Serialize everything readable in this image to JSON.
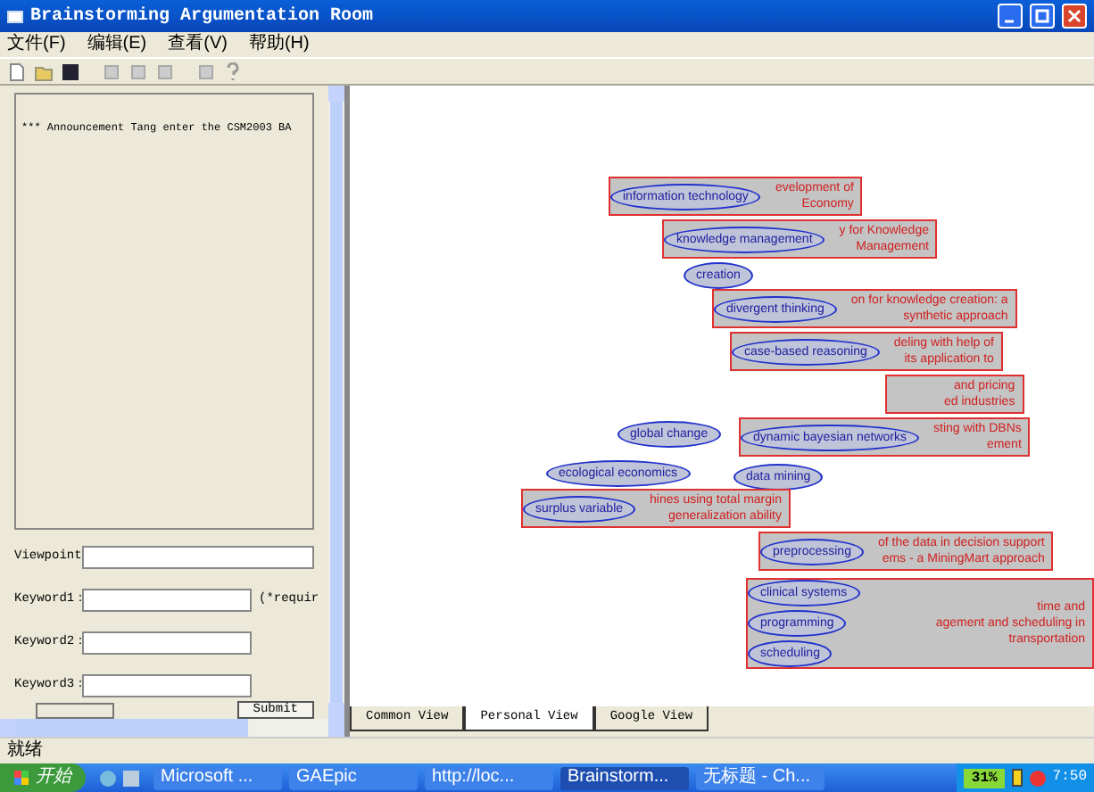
{
  "window": {
    "title": "Brainstorming Argumentation Room"
  },
  "menu": [
    "文件(F)",
    "编辑(E)",
    "查看(V)",
    "帮助(H)"
  ],
  "announcement": "*** Announcement  Tang enter the CSM2003 BA",
  "form": {
    "fields": [
      {
        "label": "Viewpoint"
      },
      {
        "label": "Keyword1：",
        "note": "(*requir"
      },
      {
        "label": "Keyword2："
      },
      {
        "label": "Keyword3："
      }
    ],
    "submit": "Submit"
  },
  "graph": {
    "nodes": [
      {
        "kind": "paper",
        "concepts": [
          "information technology"
        ],
        "lines": [
          "evelopment of",
          "Economy"
        ]
      },
      {
        "kind": "paper",
        "concepts": [
          "knowledge management"
        ],
        "lines": [
          "y for Knowledge",
          "Management"
        ]
      },
      {
        "kind": "concept",
        "label": "creation"
      },
      {
        "kind": "paper",
        "concepts": [
          "divergent thinking"
        ],
        "lines": [
          "on for knowledge creation: a",
          "synthetic approach"
        ]
      },
      {
        "kind": "paper",
        "concepts": [
          "case-based reasoning"
        ],
        "lines": [
          "deling with help of",
          "its application to"
        ]
      },
      {
        "kind": "paper",
        "lines": [
          "and pricing",
          "ed industries"
        ]
      },
      {
        "kind": "concept",
        "label": "global change"
      },
      {
        "kind": "paper",
        "concepts": [
          "dynamic bayesian networks"
        ],
        "lines": [
          "sting with DBNs",
          "ement"
        ]
      },
      {
        "kind": "concept",
        "label": "ecological economics"
      },
      {
        "kind": "concept",
        "label": "data mining"
      },
      {
        "kind": "paper",
        "concepts": [
          "surplus variable"
        ],
        "lines": [
          "hines using total margin",
          "generalization ability"
        ]
      },
      {
        "kind": "paper",
        "concepts": [
          "preprocessing"
        ],
        "lines": [
          "of the data in decision support",
          "ems - a MiningMart approach"
        ]
      },
      {
        "kind": "paper",
        "concepts": [
          "clinical systems",
          "programming",
          "scheduling"
        ],
        "lines": [
          "time and",
          "agement and scheduling in",
          "transportation"
        ]
      }
    ]
  },
  "tabs": [
    {
      "label": "Common View",
      "selected": false
    },
    {
      "label": "Personal View",
      "selected": true
    },
    {
      "label": "Google View",
      "selected": false
    }
  ],
  "status": "就绪",
  "taskbar": {
    "start": "开始",
    "tasks": [
      {
        "label": "Microsoft ...",
        "selected": false
      },
      {
        "label": "GAEpic",
        "selected": false
      },
      {
        "label": "http://loc...",
        "selected": false
      },
      {
        "label": "Brainstorm...",
        "selected": true
      },
      {
        "label": "无标题 - Ch...",
        "selected": false
      }
    ],
    "battery": "31%",
    "clock": "7:50"
  }
}
